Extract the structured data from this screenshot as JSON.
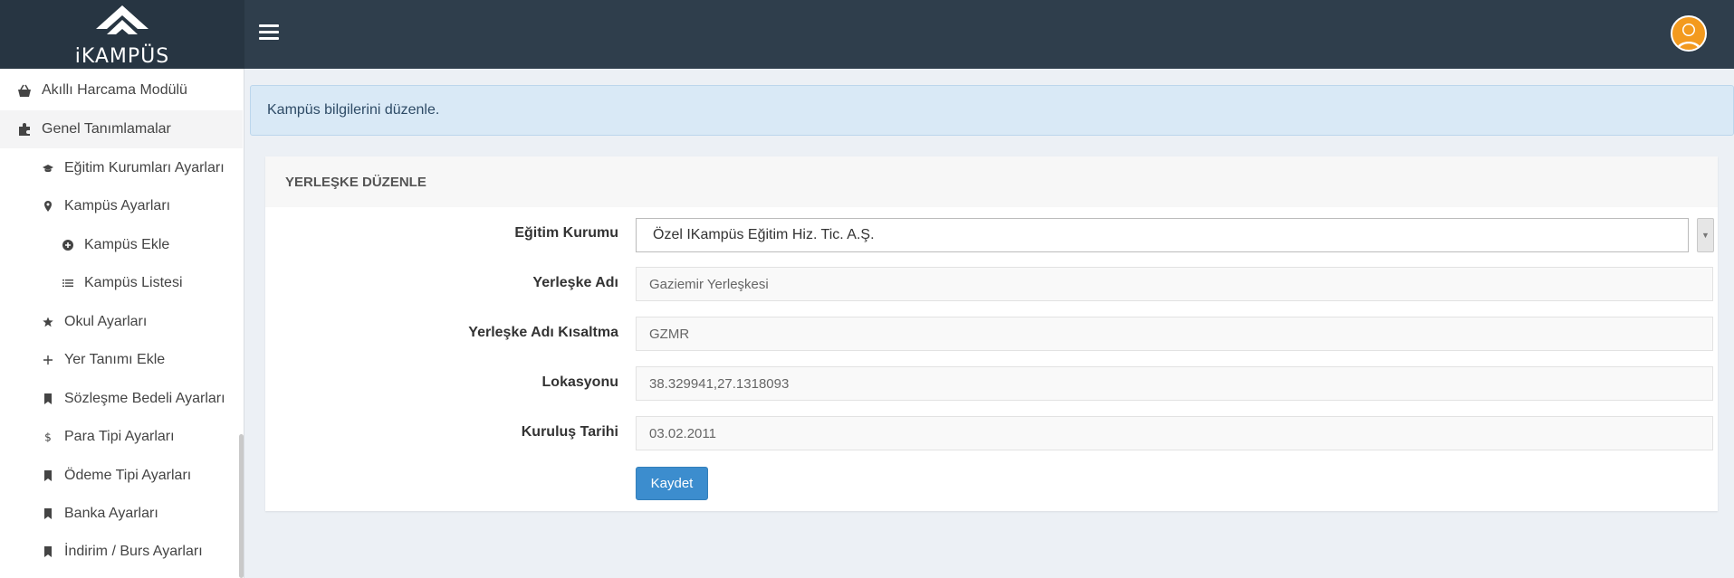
{
  "brand": {
    "logo_text": "iKAMPÜS"
  },
  "sidebar": {
    "items": [
      {
        "label": "Akıllı Harcama Modülü",
        "icon": "basket-icon"
      },
      {
        "label": "Genel Tanımlamalar",
        "icon": "puzzle-icon"
      },
      {
        "label": "Eğitim Kurumları Ayarları",
        "icon": "graduation-cap-icon"
      },
      {
        "label": "Kampüs Ayarları",
        "icon": "map-marker-icon"
      },
      {
        "label": "Kampüs Ekle",
        "icon": "plus-circle-icon"
      },
      {
        "label": "Kampüs Listesi",
        "icon": "list-icon"
      },
      {
        "label": "Okul Ayarları",
        "icon": "star-icon"
      },
      {
        "label": "Yer Tanımı Ekle",
        "icon": "plus-icon"
      },
      {
        "label": "Sözleşme Bedeli Ayarları",
        "icon": "bookmark-icon"
      },
      {
        "label": "Para Tipi Ayarları",
        "icon": "dollar-icon"
      },
      {
        "label": "Ödeme Tipi Ayarları",
        "icon": "bookmark-icon"
      },
      {
        "label": "Banka Ayarları",
        "icon": "bookmark-icon"
      },
      {
        "label": "İndirim / Burs Ayarları",
        "icon": "bookmark-icon"
      }
    ]
  },
  "alert": {
    "text": "Kampüs bilgilerini düzenle."
  },
  "panel": {
    "title": "YERLEŞKE DÜZENLE",
    "fields": {
      "institution": {
        "label": "Eğitim Kurumu",
        "value": "Özel IKampüs Eğitim Hiz. Tic. A.Ş."
      },
      "campus_name": {
        "label": "Yerleşke Adı",
        "value": "Gaziemir Yerleşkesi"
      },
      "campus_abbr": {
        "label": "Yerleşke Adı Kısaltma",
        "value": "GZMR"
      },
      "location": {
        "label": "Lokasyonu",
        "value": "38.329941,27.1318093"
      },
      "founded": {
        "label": "Kuruluş Tarihi",
        "value": "03.02.2011"
      }
    },
    "save_label": "Kaydet"
  },
  "colors": {
    "topbar": "#2f3e4c",
    "logo_bg": "#273542",
    "primary_button": "#3c8dce",
    "alert_bg": "#d9e9f6",
    "avatar": "#f39a1e"
  }
}
